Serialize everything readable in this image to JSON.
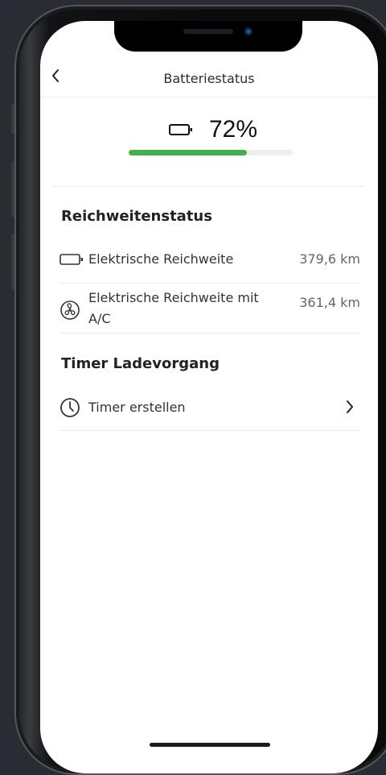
{
  "header": {
    "title": "Batteriestatus"
  },
  "battery": {
    "percent_label": "72%",
    "level": 0.72,
    "bar_color": "#3fb04b"
  },
  "range_section": {
    "title": "Reichweitenstatus",
    "rows": [
      {
        "label": "Elektrische Reichweite",
        "value": "379,6 km",
        "icon": "battery-icon"
      },
      {
        "label_line1": "Elektrische Reichweite mit",
        "label_line2": "A/C",
        "value": "361,4 km",
        "icon": "fan-icon"
      }
    ]
  },
  "timer_section": {
    "title": "Timer Ladevorgang",
    "rows": [
      {
        "label": "Timer erstellen",
        "icon": "clock-icon"
      }
    ]
  }
}
